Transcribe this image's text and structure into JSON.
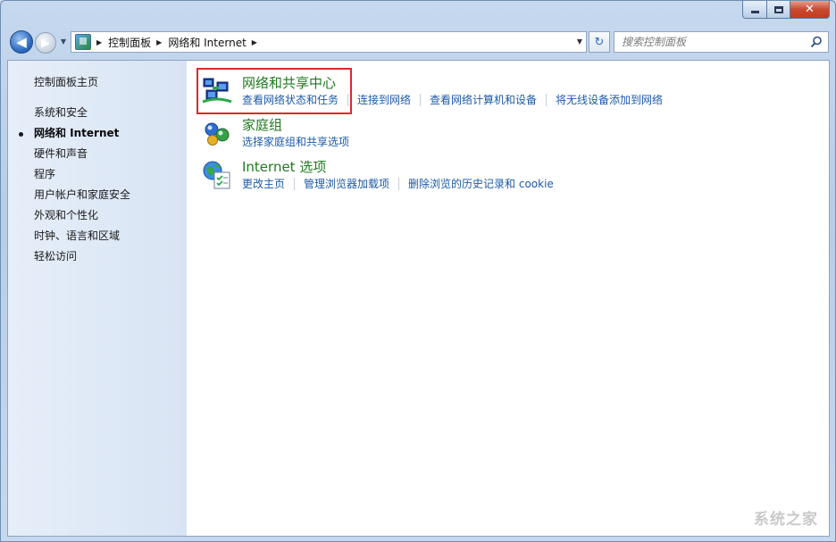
{
  "window": {
    "caption": {
      "minimize_icon": "minimize-icon",
      "maximize_icon": "maximize-icon",
      "close_glyph": "✕"
    }
  },
  "nav": {
    "back_glyph": "◀",
    "forward_glyph": "▶",
    "dropdown_glyph": "▼",
    "breadcrumb": [
      "控制面板",
      "网络和 Internet"
    ],
    "refresh_glyph": "↻",
    "search_placeholder": "搜索控制面板"
  },
  "sidebar": {
    "items": [
      {
        "label": "控制面板主页"
      },
      {
        "label": "系统和安全"
      },
      {
        "label": "网络和 Internet",
        "current": true
      },
      {
        "label": "硬件和声音"
      },
      {
        "label": "程序"
      },
      {
        "label": "用户帐户和家庭安全"
      },
      {
        "label": "外观和个性化"
      },
      {
        "label": "时钟、语言和区域"
      },
      {
        "label": "轻松访问"
      }
    ]
  },
  "categories": [
    {
      "title": "网络和共享中心",
      "icon": "network-sharing-center-icon",
      "links": [
        "查看网络状态和任务",
        "连接到网络",
        "查看网络计算机和设备",
        "将无线设备添加到网络"
      ]
    },
    {
      "title": "家庭组",
      "icon": "homegroup-icon",
      "links": [
        "选择家庭组和共享选项"
      ]
    },
    {
      "title": "Internet 选项",
      "icon": "internet-options-icon",
      "links": [
        "更改主页",
        "管理浏览器加载项",
        "删除浏览的历史记录和 cookie"
      ]
    }
  ],
  "watermark": "系统之家",
  "colors": {
    "title_green": "#1e7a1e",
    "link_blue": "#1c5aa8",
    "highlight_red": "#d92a2a"
  }
}
